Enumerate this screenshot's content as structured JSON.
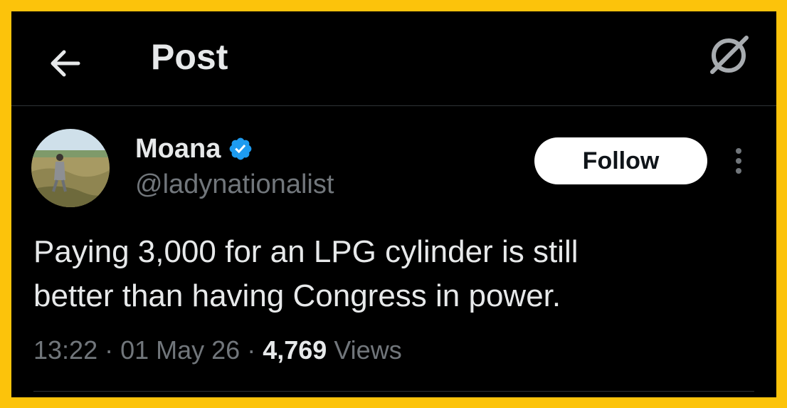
{
  "header": {
    "title": "Post",
    "back_icon": "arrow-left-icon",
    "right_icon": "grok-icon"
  },
  "author": {
    "display_name": "Moana",
    "handle": "@ladynationalist",
    "verified_icon": "verified-badge-icon",
    "verified_color": "#1d9bf0"
  },
  "actions": {
    "follow_label": "Follow",
    "more_icon": "more-vertical-icon"
  },
  "post": {
    "text_lines": [
      "Paying 3,000 for an LPG cylinder is still",
      "better than having Congress in power."
    ]
  },
  "meta": {
    "time": "13:22",
    "separator": " · ",
    "date": "01 May 26",
    "views_count": "4,769",
    "views_label": "Views"
  },
  "colors": {
    "frame_border": "#fcc30b",
    "background": "#000000",
    "primary_text": "#e7e9ea",
    "secondary_text": "#71767b",
    "divider": "#2f3336"
  }
}
